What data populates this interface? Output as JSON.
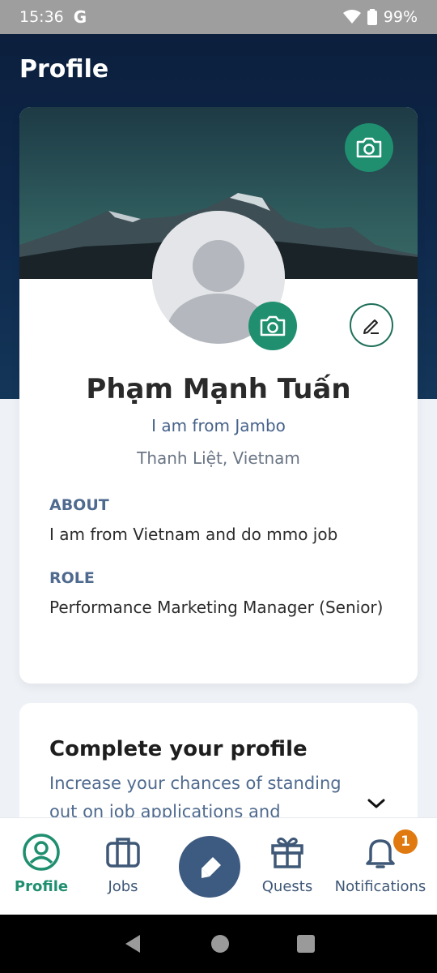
{
  "status": {
    "time": "15:36",
    "carrier_icon": "G",
    "battery": "99%"
  },
  "header": {
    "title": "Profile"
  },
  "profile": {
    "name": "Phạm Mạnh Tuấn",
    "tagline": "I am from Jambo",
    "location": "Thanh Liệt, Vietnam",
    "about_label": "ABOUT",
    "about_text": "I am from Vietnam and do mmo job",
    "role_label": "ROLE",
    "role_text": "Performance Marketing Manager (Senior)"
  },
  "complete": {
    "title": "Complete your profile",
    "text": "Increase your chances of standing out on job applications and"
  },
  "nav": {
    "profile": "Profile",
    "jobs": "Jobs",
    "quests": "Quests",
    "notifications": "Notifications",
    "notifications_badge": "1"
  },
  "colors": {
    "accent": "#1f8f6f",
    "header": "#0c1f3d",
    "badge": "#e07a10",
    "nav": "#3d5a80"
  }
}
